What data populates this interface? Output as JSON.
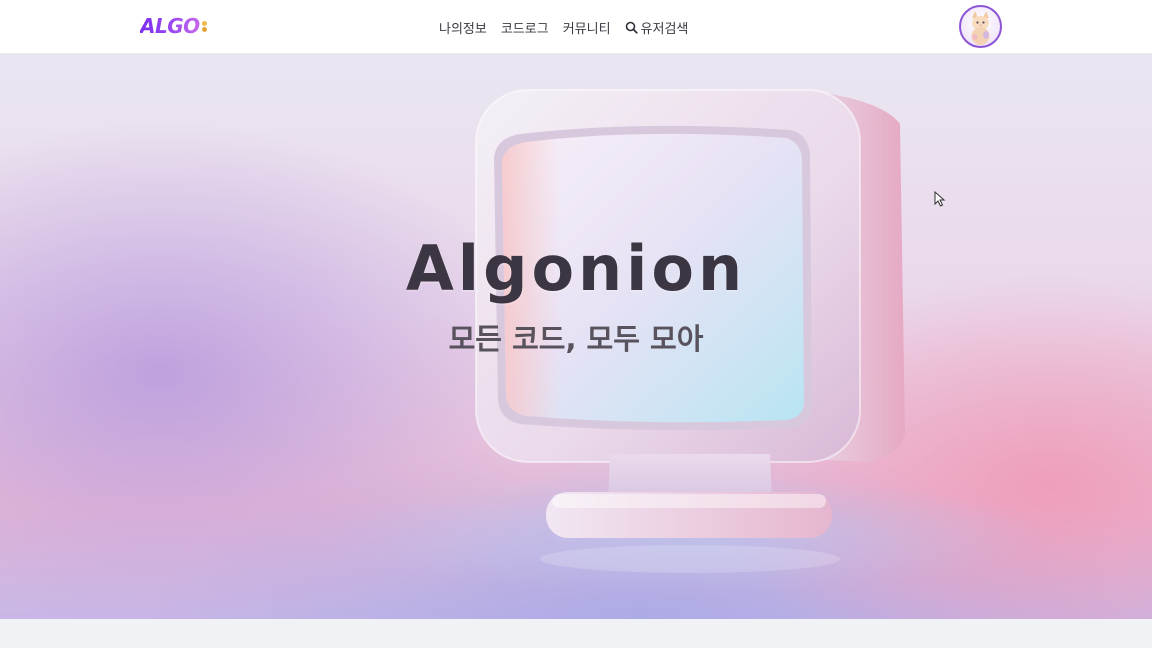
{
  "brand": {
    "logo_text": "ALGO",
    "accent_color": "#7a2ff0"
  },
  "nav": {
    "items": [
      {
        "label": "나의정보"
      },
      {
        "label": "코드로그"
      },
      {
        "label": "커뮤니티"
      },
      {
        "label": "유저검색",
        "icon": "search-icon"
      }
    ]
  },
  "user": {
    "avatar_icon": "cat-avatar-icon",
    "avatar_border_color": "#8d55d6"
  },
  "hero": {
    "title": "Algonion",
    "subtitle": "모든 코드, 모두 모아",
    "image_icon": "retro-monitor-illustration"
  }
}
